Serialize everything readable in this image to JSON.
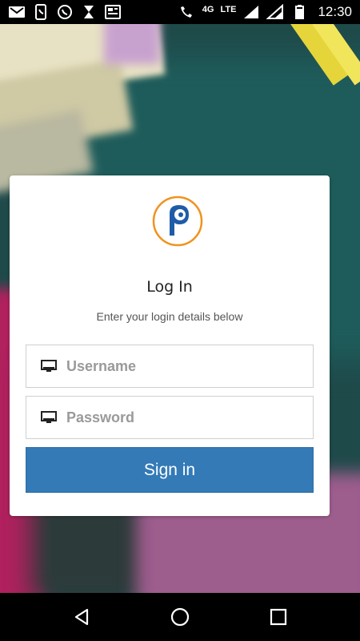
{
  "status_bar": {
    "left_icons": [
      "gmail-icon",
      "phone-app-icon",
      "whatsapp-icon",
      "hourglass-icon",
      "news-icon"
    ],
    "network_label": "LTE",
    "network_sub_label": "4G",
    "time": "12:30"
  },
  "login_card": {
    "logo": "p-logo-icon",
    "title": "Log In",
    "subtitle": "Enter your login details below",
    "username": {
      "placeholder": "Username",
      "value": ""
    },
    "password": {
      "placeholder": "Password",
      "value": ""
    },
    "sign_in_label": "Sign in"
  },
  "colors": {
    "primary_button": "#337ab7",
    "logo_orange": "#f0931e",
    "logo_blue": "#1f5ca8"
  },
  "nav_bar": {
    "buttons": [
      "back-icon",
      "home-icon",
      "recents-icon"
    ]
  }
}
